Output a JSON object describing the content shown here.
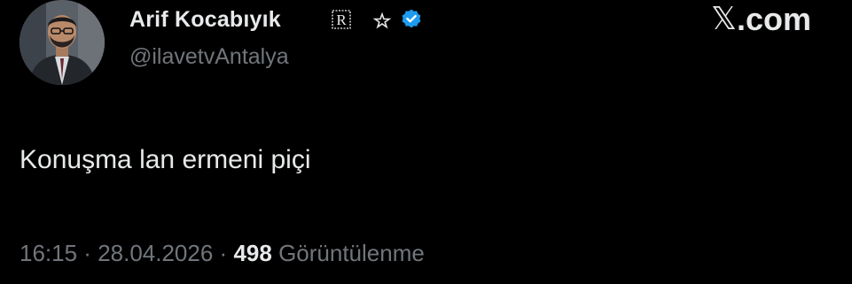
{
  "author": {
    "display_name": "Arif Kocabıyık",
    "handle": "@ilavetvAntalya",
    "emblem_letter": "R",
    "verified": true
  },
  "brand": {
    "x_glyph": "𝕏",
    "domain": ".com"
  },
  "tweet": {
    "text": "Konuşma lan ermeni piçi"
  },
  "meta": {
    "time": "16:15",
    "separator": " · ",
    "date": "28.04.2026",
    "views": "498",
    "views_label": "Görüntülenme"
  },
  "colors": {
    "background": "#000000",
    "primary_text": "#e7e9ea",
    "secondary_text": "#71767b",
    "verified_blue": "#1d9bf0"
  }
}
